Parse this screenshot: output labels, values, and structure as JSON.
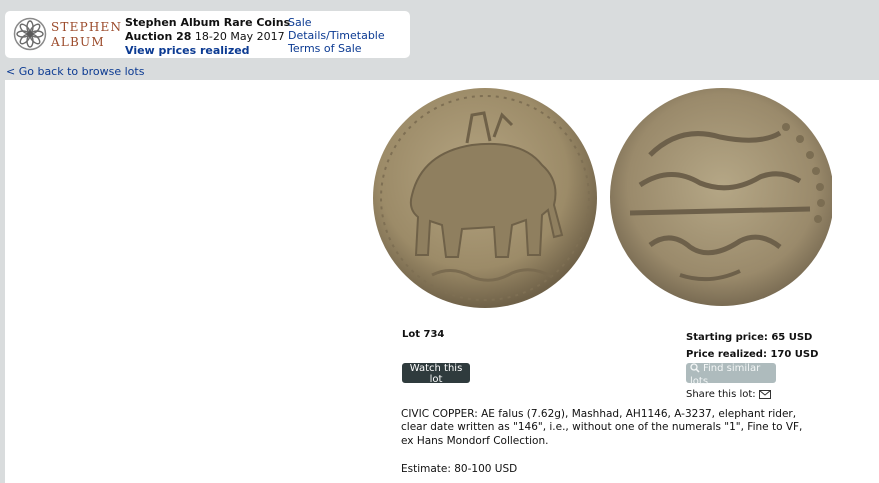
{
  "brand": {
    "logo_line1": "STEPHEN",
    "logo_line2": "ALBUM"
  },
  "auction": {
    "house": "Stephen Album Rare Coins",
    "number": "Auction 28",
    "dates": "18-20 May 2017",
    "prices_link": "View prices realized"
  },
  "header_links": {
    "sale_details": "Sale Details/Timetable",
    "terms": "Terms of Sale"
  },
  "navigation": {
    "back": "< Go back to browse lots"
  },
  "lot": {
    "number": "Lot 734",
    "watch_label": "Watch this lot",
    "starting_price": "Starting price: 65 USD",
    "price_realized": "Price realized: 170 USD",
    "similar_label": "Find similar lots",
    "share_label": "Share this lot:",
    "description": "CIVIC COPPER: AE falus (7.62g), Mashhad, AH1146, A-3237, elephant rider, clear date written as \"146\", i.e., without one of the numerals \"1\", Fine to VF, ex Hans Mondorf Collection.",
    "estimate": "Estimate: 80-100 USD"
  },
  "icons": {
    "logo_seal": "rosette-seal-icon",
    "search": "search-icon",
    "envelope": "envelope-icon"
  },
  "colors": {
    "link": "#0b3a92",
    "logo_text": "#9b4a2a",
    "watch_button": "#2f3b3d",
    "similar_button": "#aebbbd",
    "background": "#d9dcdd"
  }
}
